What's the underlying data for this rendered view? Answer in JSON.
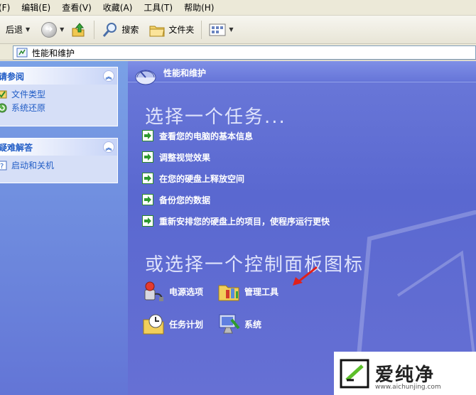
{
  "menu": [
    {
      "label": "(F)"
    },
    {
      "label": "编辑(E)"
    },
    {
      "label": "查看(V)"
    },
    {
      "label": "收藏(A)"
    },
    {
      "label": "工具(T)"
    },
    {
      "label": "帮助(H)"
    }
  ],
  "toolbar": {
    "back_label": "后退",
    "search_label": "搜索",
    "folders_label": "文件夹"
  },
  "address": {
    "label": "",
    "path": "性能和维护"
  },
  "left": {
    "see_also": {
      "title": "请参阅",
      "items": [
        "文件类型",
        "系统还原"
      ]
    },
    "troubleshoot": {
      "title": "疑难解答",
      "items": [
        "启动和关机"
      ]
    }
  },
  "main": {
    "title": "性能和维护",
    "pick_task": "选择一个任务...",
    "tasks": [
      "查看您的电脑的基本信息",
      "调整视觉效果",
      "在您的硬盘上释放空间",
      "备份您的数据",
      "重新安排您的硬盘上的项目，使程序运行更快"
    ],
    "pick_icon": "或选择一个控制面板图标",
    "icons": [
      {
        "label": "电源选项",
        "icon": "power-icon"
      },
      {
        "label": "管理工具",
        "icon": "admin-tools-icon"
      },
      {
        "label": "任务计划",
        "icon": "scheduled-tasks-icon"
      },
      {
        "label": "系统",
        "icon": "system-icon"
      }
    ]
  },
  "watermark": {
    "brand": "爱纯净",
    "url": "www.aichunjing.com"
  },
  "colors": {
    "accent_link": "#215dc6",
    "main_bg": "#6170d4",
    "annotation_arrow": "#e0201b"
  }
}
